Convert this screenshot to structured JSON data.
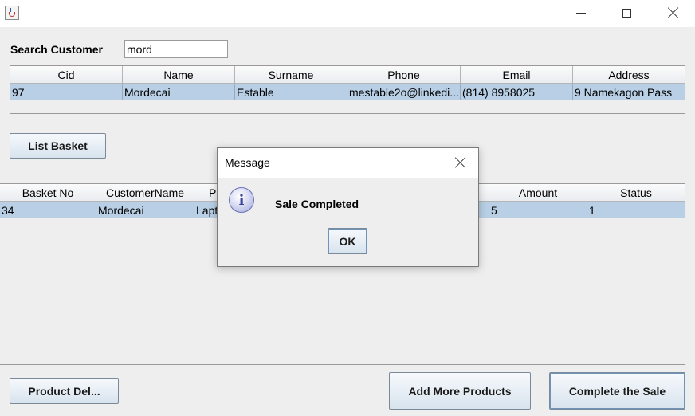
{
  "window": {
    "title": "",
    "icon": "java-cup-icon",
    "controls": {
      "minimize": "minimize-icon",
      "maximize": "maximize-icon",
      "close": "close-icon"
    }
  },
  "search": {
    "label": "Search Customer",
    "value": "mord"
  },
  "customer_table": {
    "columns": [
      "Cid",
      "Name",
      "Surname",
      "Phone",
      "Email",
      "Address"
    ],
    "rows": [
      [
        "97",
        "Mordecai",
        "Estable",
        "mestable2o@linkedi...",
        "(814) 8958025",
        "9 Namekagon Pass"
      ]
    ]
  },
  "buttons": {
    "list_basket": "List Basket",
    "product_del": "Product Del...",
    "add_more_products": "Add More Products",
    "complete_sale": "Complete the Sale"
  },
  "basket_table": {
    "columns": [
      "Basket No",
      "CustomerName",
      "P",
      "",
      "Amount",
      "Status"
    ],
    "rows": [
      [
        "34",
        "Mordecai",
        "Lapt",
        "",
        "5",
        "1"
      ]
    ]
  },
  "dialog": {
    "title": "Message",
    "message": "Sale Completed",
    "ok_label": "OK",
    "icon": "information-icon"
  },
  "colors": {
    "selection": "#b8cfe5",
    "background": "#eeeeee",
    "button_gradient_top": "#f6f9fc",
    "button_gradient_bottom": "#d8e3ee"
  }
}
